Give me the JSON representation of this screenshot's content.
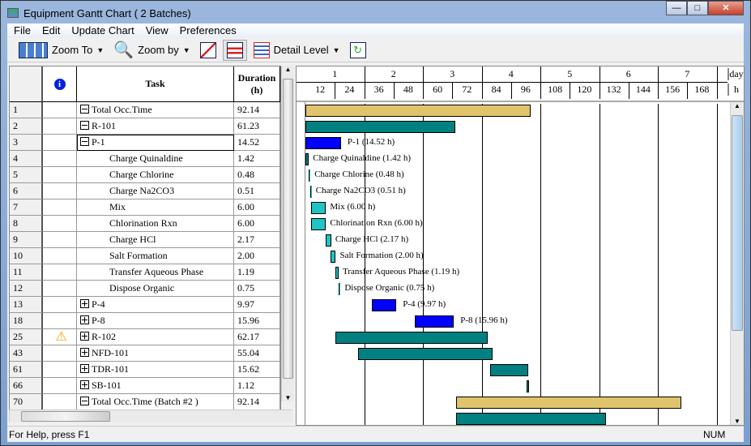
{
  "window": {
    "title": "Equipment Gantt Chart ( 2 Batches)"
  },
  "menu": [
    "File",
    "Edit",
    "Update Chart",
    "View",
    "Preferences"
  ],
  "toolbar": {
    "zoom_to": "Zoom To",
    "zoom_by": "Zoom by",
    "detail_level": "Detail Level"
  },
  "table": {
    "headers": {
      "info": "i",
      "task": "Task",
      "duration": "Duration (h)"
    },
    "rows": [
      {
        "n": "1",
        "task": "Total Occ.Time",
        "dur": "92.14",
        "level": 0,
        "toggle": "minus"
      },
      {
        "n": "2",
        "task": "R-101",
        "dur": "61.23",
        "level": 0,
        "toggle": "minus"
      },
      {
        "n": "3",
        "task": "P-1",
        "dur": "14.52",
        "level": 0,
        "toggle": "minus",
        "selected": true
      },
      {
        "n": "4",
        "task": "Charge Quinaldine",
        "dur": "1.42",
        "level": 1
      },
      {
        "n": "5",
        "task": "Charge Chlorine",
        "dur": "0.48",
        "level": 1
      },
      {
        "n": "6",
        "task": "Charge Na2CO3",
        "dur": "0.51",
        "level": 1
      },
      {
        "n": "7",
        "task": "Mix",
        "dur": "6.00",
        "level": 1
      },
      {
        "n": "8",
        "task": "Chlorination Rxn",
        "dur": "6.00",
        "level": 1
      },
      {
        "n": "9",
        "task": "Charge HCl",
        "dur": "2.17",
        "level": 1
      },
      {
        "n": "10",
        "task": "Salt Formation",
        "dur": "2.00",
        "level": 1
      },
      {
        "n": "11",
        "task": "Transfer Aqueous Phase",
        "dur": "1.19",
        "level": 1
      },
      {
        "n": "12",
        "task": "Dispose Organic",
        "dur": "0.75",
        "level": 1
      },
      {
        "n": "13",
        "task": "P-4",
        "dur": "9.97",
        "level": 0,
        "toggle": "plus"
      },
      {
        "n": "18",
        "task": "P-8",
        "dur": "15.96",
        "level": 0,
        "toggle": "plus"
      },
      {
        "n": "25",
        "task": "R-102",
        "dur": "62.17",
        "level": 0,
        "toggle": "plus",
        "warning": true
      },
      {
        "n": "43",
        "task": "NFD-101",
        "dur": "55.04",
        "level": 0,
        "toggle": "plus"
      },
      {
        "n": "61",
        "task": "TDR-101",
        "dur": "15.62",
        "level": 0,
        "toggle": "plus"
      },
      {
        "n": "66",
        "task": "SB-101",
        "dur": "1.12",
        "level": 0,
        "toggle": "plus"
      },
      {
        "n": "70",
        "task": "Total Occ.Time (Batch #2 )",
        "dur": "92.14",
        "level": 0,
        "toggle": "minus"
      }
    ]
  },
  "chart_data": {
    "type": "gantt",
    "x_unit_top": "day",
    "x_unit_bottom": "h",
    "xlim": [
      0,
      180
    ],
    "day_ticks": [
      "1",
      "2",
      "3",
      "4",
      "5",
      "6",
      "7"
    ],
    "hour_ticks": [
      "12",
      "24",
      "36",
      "48",
      "60",
      "72",
      "84",
      "96",
      "108",
      "120",
      "132",
      "144",
      "156",
      "168"
    ],
    "colors": {
      "total": "#e0c46c",
      "equipment": "#008080",
      "procedure": "#0000ff",
      "operation": "#20c4c4",
      "operation_dark": "#008080"
    },
    "bars": [
      {
        "start": 0,
        "dur": 92.14,
        "kind": "total"
      },
      {
        "start": 0,
        "dur": 61.23,
        "kind": "equipment"
      },
      {
        "start": 0,
        "dur": 14.52,
        "kind": "procedure",
        "label": "P-1 (14.52 h)"
      },
      {
        "start": 0,
        "dur": 1.42,
        "kind": "operation_dark",
        "label": "Charge Quinaldine (1.42 h)"
      },
      {
        "start": 1.4,
        "dur": 0.48,
        "kind": "operation",
        "label": "Charge Chlorine (0.48 h)"
      },
      {
        "start": 1.9,
        "dur": 0.51,
        "kind": "operation",
        "label": "Charge Na2CO3 (0.51 h)"
      },
      {
        "start": 2.4,
        "dur": 6.0,
        "kind": "operation",
        "label": "Mix (6.00 h)"
      },
      {
        "start": 2.4,
        "dur": 6.0,
        "kind": "operation",
        "label": "Chlorination Rxn (6.00 h)"
      },
      {
        "start": 8.4,
        "dur": 2.17,
        "kind": "operation",
        "label": "Charge HCl (2.17 h)"
      },
      {
        "start": 10.4,
        "dur": 2.0,
        "kind": "operation",
        "label": "Salt Formation (2.00 h)"
      },
      {
        "start": 12.4,
        "dur": 1.19,
        "kind": "operation",
        "label": "Transfer Aqueous Phase (1.19 h)"
      },
      {
        "start": 13.6,
        "dur": 0.75,
        "kind": "operation",
        "label": "Dispose Organic (0.75 h)"
      },
      {
        "start": 27.2,
        "dur": 9.97,
        "kind": "procedure",
        "label": "P-4 (9.97 h)"
      },
      {
        "start": 44.7,
        "dur": 15.96,
        "kind": "procedure",
        "label": "P-8 (15.96 h)"
      },
      {
        "start": 12.3,
        "dur": 62.17,
        "kind": "equipment"
      },
      {
        "start": 21.5,
        "dur": 55.04,
        "kind": "equipment"
      },
      {
        "start": 75.4,
        "dur": 15.62,
        "kind": "equipment"
      },
      {
        "start": 90.3,
        "dur": 1.12,
        "kind": "equipment"
      },
      {
        "start": 61.6,
        "dur": 92.14,
        "kind": "total"
      },
      {
        "start": 61.6,
        "dur": 61.23,
        "kind": "equipment"
      }
    ]
  },
  "status": {
    "help": "For Help, press F1",
    "num": "NUM"
  }
}
